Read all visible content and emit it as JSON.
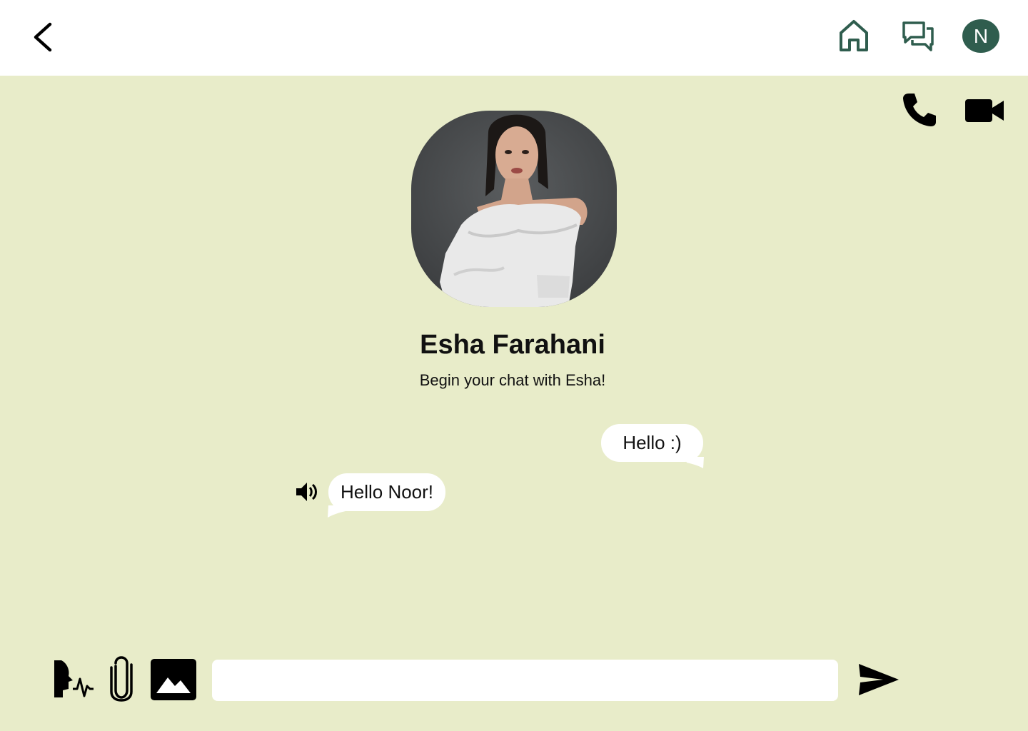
{
  "header": {
    "back_icon": "chevron-left-icon",
    "home_icon": "home-icon",
    "messages_icon": "chat-bubbles-icon",
    "avatar_initial": "N",
    "avatar_color": "#2f5d4e",
    "icon_color": "#2f5d4e"
  },
  "call_actions": {
    "phone_icon": "phone-icon",
    "video_icon": "video-camera-icon"
  },
  "contact": {
    "name": "Esha Farahani",
    "subtitle": "Begin your chat with Esha!"
  },
  "messages": [
    {
      "direction": "sent",
      "text": "Hello :)"
    },
    {
      "direction": "received",
      "text": "Hello Noor!",
      "has_audio": true
    }
  ],
  "composer": {
    "voice_icon": "voice-wave-icon",
    "attach_icon": "paperclip-icon",
    "image_icon": "image-icon",
    "input_value": "",
    "input_placeholder": "",
    "send_icon": "send-icon"
  },
  "theme": {
    "background": "#e8ecc9",
    "bubble": "#ffffff",
    "topbar": "#ffffff"
  }
}
